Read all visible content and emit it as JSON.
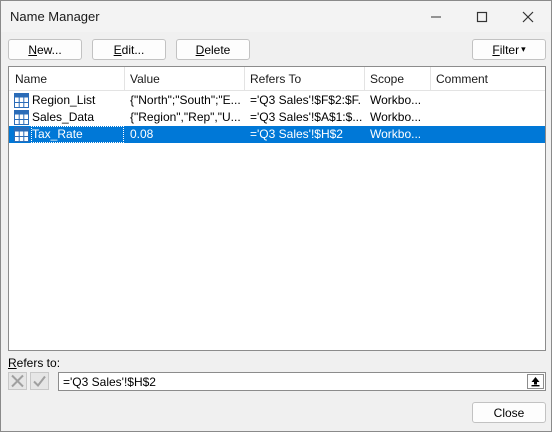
{
  "window": {
    "title": "Name Manager",
    "controls": [
      "minimize-icon",
      "maximize-icon",
      "close-icon"
    ]
  },
  "toolbar": {
    "new_label_ul": "N",
    "new_label_rest": "ew...",
    "edit_label_ul": "E",
    "edit_label_rest": "dit...",
    "delete_label_ul": "D",
    "delete_label_rest": "elete",
    "filter_label_ul": "F",
    "filter_label_rest": "ilter",
    "filter_arrow": "▾"
  },
  "table": {
    "columns": [
      "Name",
      "Value",
      "Refers To",
      "Scope",
      "Comment"
    ],
    "rows": [
      {
        "name": "Region_List",
        "value": "{\"North\";\"South\";\"E...",
        "refers_to": "='Q3 Sales'!$F$2:$F...",
        "scope": "Workbo...",
        "comment": ""
      },
      {
        "name": "Sales_Data",
        "value": "{\"Region\",\"Rep\",\"U...",
        "refers_to": "='Q3 Sales'!$A$1:$...",
        "scope": "Workbo...",
        "comment": ""
      },
      {
        "name": "Tax_Rate",
        "value": "0.08",
        "refers_to": "='Q3 Sales'!$H$2",
        "scope": "Workbo...",
        "comment": ""
      }
    ],
    "selected_index": 2
  },
  "refers": {
    "label_ul": "R",
    "label_rest": "efers to:",
    "value": "='Q3 Sales'!$H$2"
  },
  "footer": {
    "close_label": "Close"
  },
  "colors": {
    "selection": "#0078d7",
    "grid_icon": "#2b6cb8"
  }
}
